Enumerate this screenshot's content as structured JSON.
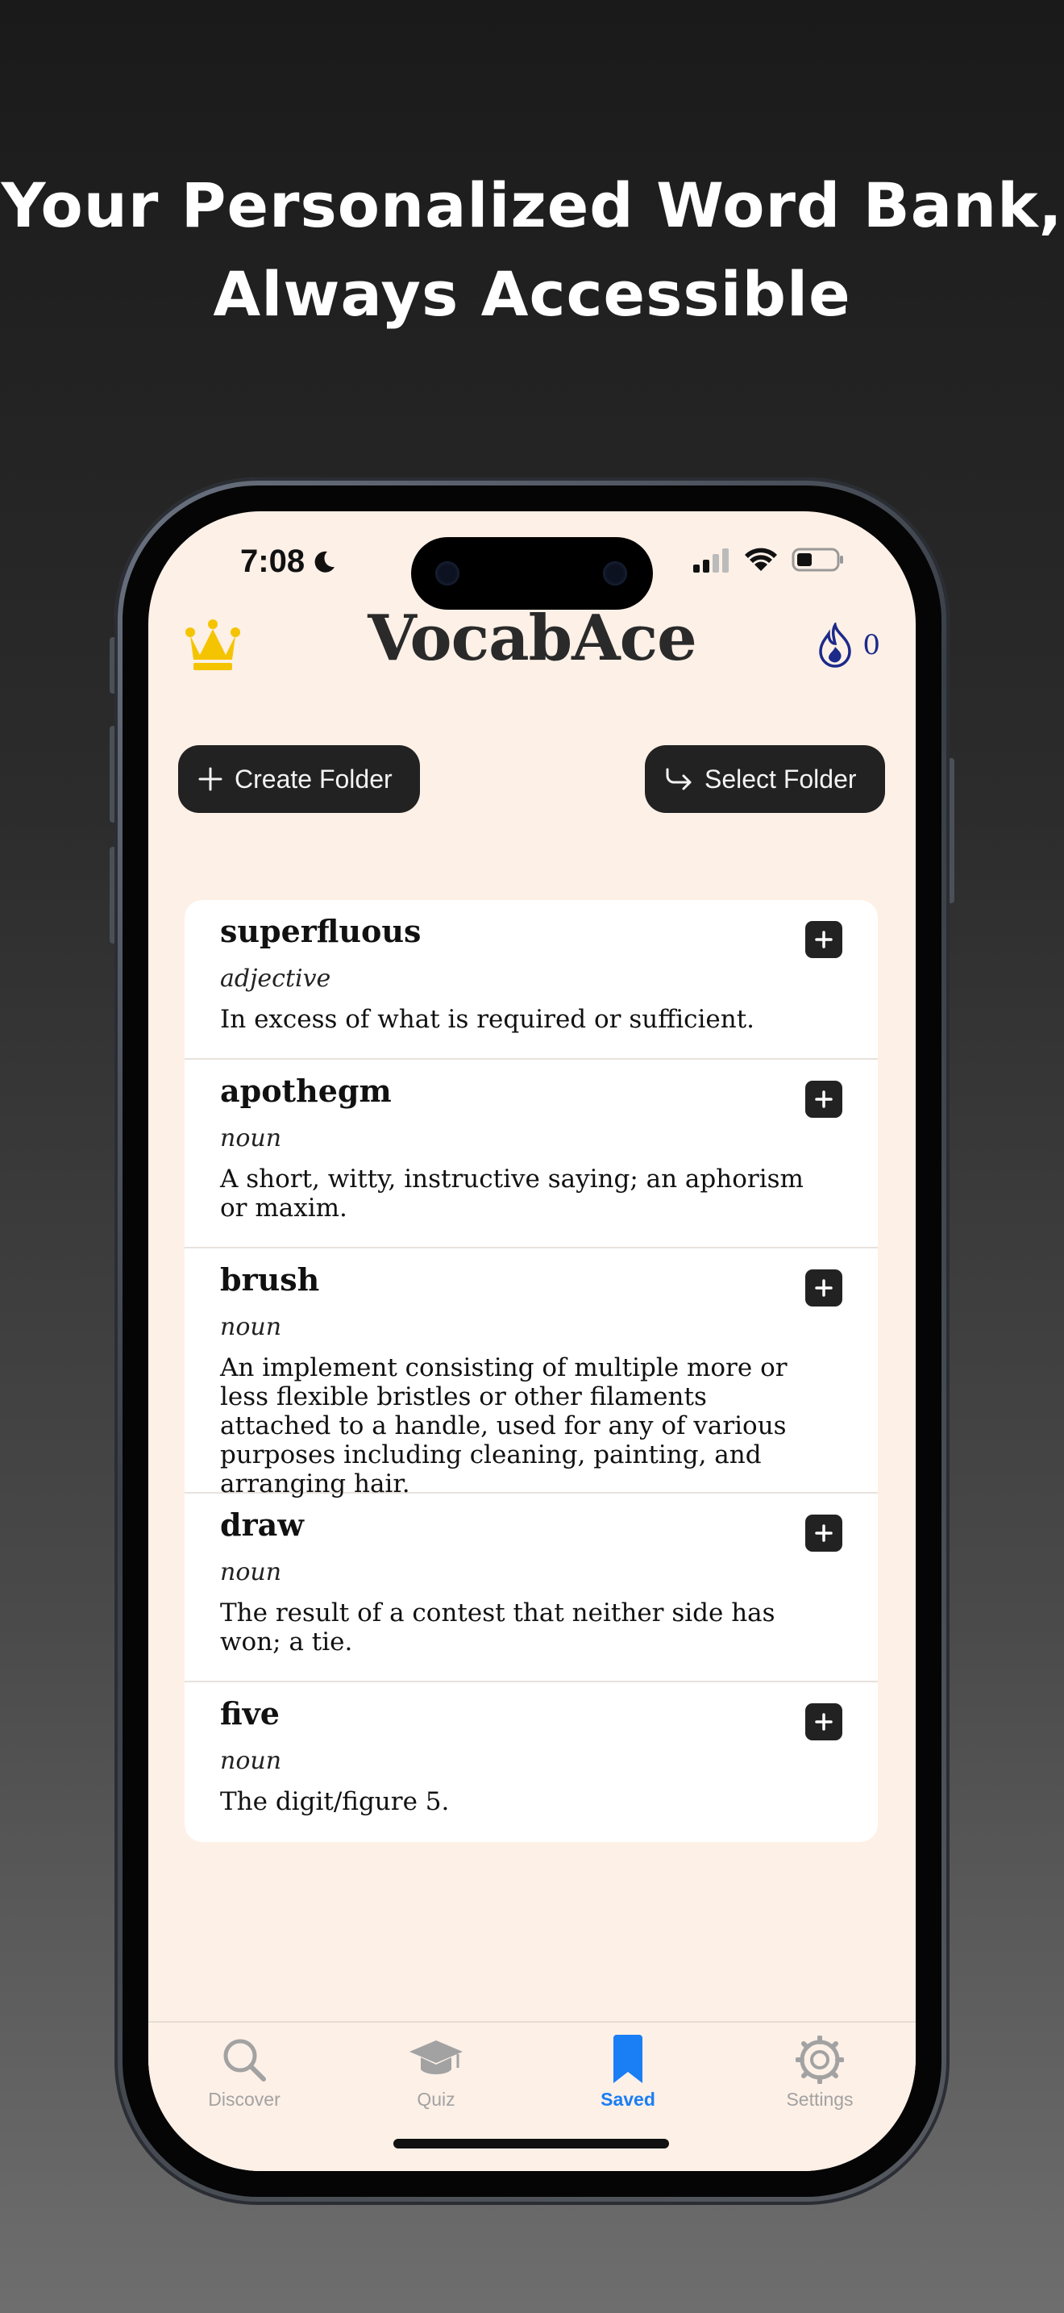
{
  "headline": {
    "line1": "Your Personalized Word Bank,",
    "line2": "Always Accessible"
  },
  "status_bar": {
    "time": "7:08"
  },
  "app": {
    "title": "VocabAce",
    "streak_count": "0",
    "create_folder_label": "Create Folder",
    "select_folder_label": "Select Folder"
  },
  "entries": [
    {
      "word": "superfluous",
      "pos": "adjective",
      "definition": "In excess of what is required or sufficient."
    },
    {
      "word": "apothegm",
      "pos": "noun",
      "definition": "A short, witty, instructive saying; an aphorism or maxim."
    },
    {
      "word": "brush",
      "pos": "noun",
      "definition": "An implement consisting of multiple more or less flexible bristles or other filaments attached to a handle, used for any of various purposes including cleaning, painting, and arranging hair."
    },
    {
      "word": "draw",
      "pos": "noun",
      "definition": "The result of a contest that neither side has won; a tie."
    },
    {
      "word": "five",
      "pos": "noun",
      "definition": "The digit/figure 5."
    }
  ],
  "tabs": [
    {
      "label": "Discover",
      "icon": "search-icon",
      "active": false
    },
    {
      "label": "Quiz",
      "icon": "graduation-cap-icon",
      "active": false
    },
    {
      "label": "Saved",
      "icon": "bookmark-icon",
      "active": true
    },
    {
      "label": "Settings",
      "icon": "gear-icon",
      "active": false
    }
  ],
  "colors": {
    "screen_background": "#fdf0e7",
    "accent_active_tab": "#1a7ef5",
    "crown": "#f5c400",
    "streak_flame": "#1c2a8a",
    "pill_background": "#222222"
  }
}
